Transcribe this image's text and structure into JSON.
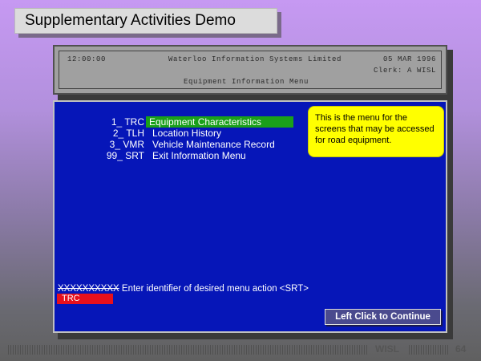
{
  "slide": {
    "title": "Supplementary Activities Demo"
  },
  "header": {
    "time": "12:00:00",
    "company": "Waterloo Information Systems Limited",
    "date": "05 MAR 1996",
    "clerk": "Clerk: A WISL",
    "menu_title": "Equipment Information Menu"
  },
  "menu": {
    "items": [
      {
        "code": "1_ TRC",
        "label": "Equipment Characteristics",
        "selected": true
      },
      {
        "code": "2_ TLH",
        "label": "Location History",
        "selected": false
      },
      {
        "code": "3_ VMR",
        "label": "Vehicle Maintenance Record",
        "selected": false
      },
      {
        "code": "99_ SRT",
        "label": "Exit Information Menu",
        "selected": false
      }
    ]
  },
  "tooltip": {
    "text": "This is the menu for the screens that may be accessed for road equipment."
  },
  "prompt": {
    "mask": "XXXXXXXXXX",
    "text": " Enter identifier of desired menu action <SRT>",
    "input_value": "TRC"
  },
  "continue_button": {
    "label": "Left Click to Continue"
  },
  "footer": {
    "brand": "WISL",
    "page_number": "64"
  },
  "colors": {
    "screen_blue": "#0616b8",
    "selection_green": "#1aa01a",
    "input_red": "#e8101c",
    "tooltip_yellow": "#ffff00"
  }
}
